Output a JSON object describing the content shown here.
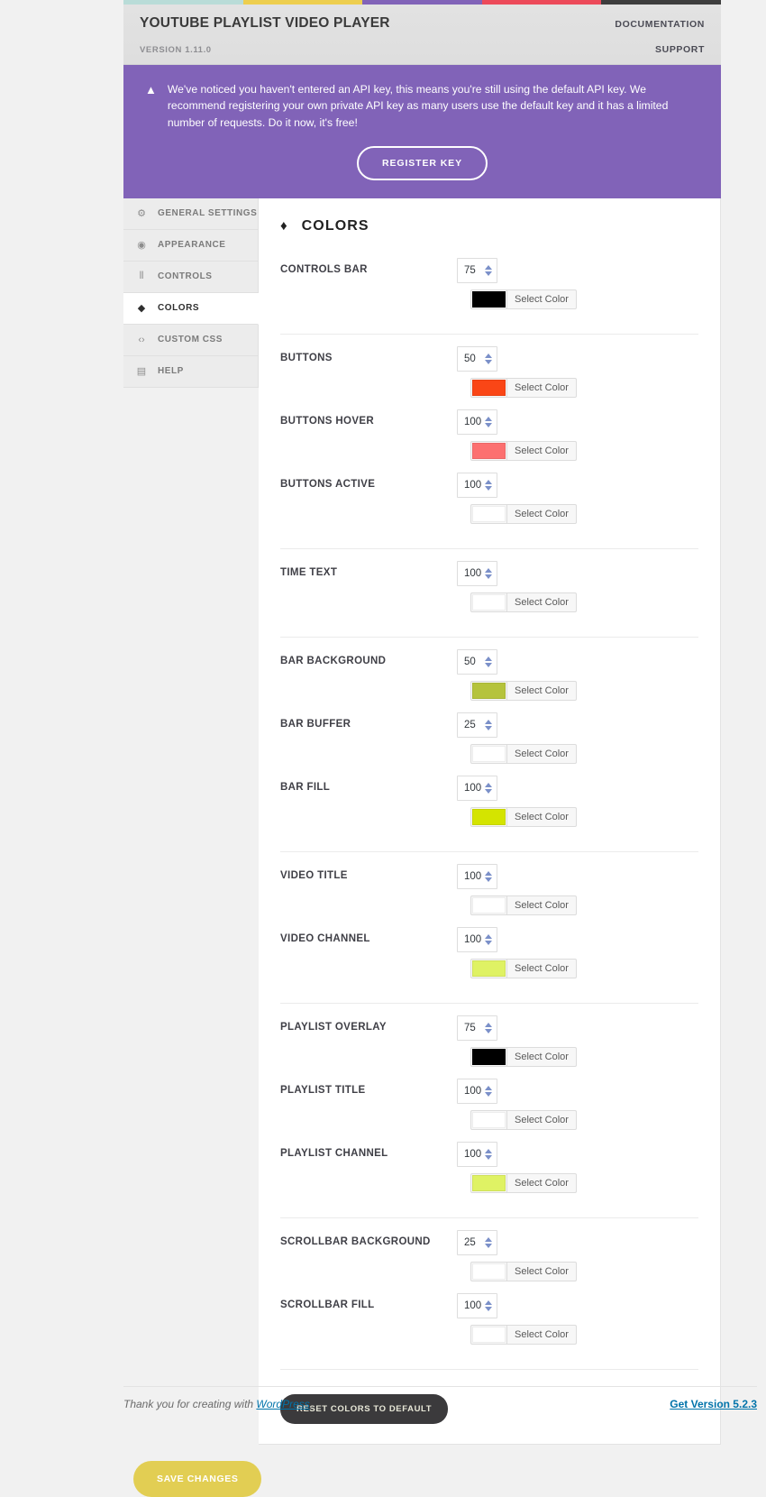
{
  "stripe_colors": [
    "#b9dcd8",
    "#edce4f",
    "#8163b8",
    "#ec4a5a",
    "#3d3d3d"
  ],
  "header": {
    "title": "YOUTUBE PLAYLIST VIDEO PLAYER",
    "version": "VERSION 1.11.0",
    "documentation": "DOCUMENTATION",
    "support": "SUPPORT"
  },
  "notice": {
    "icon": "warning-icon",
    "text": "We've noticed you haven't entered an API key, this means you're still using the default API key. We recommend registering your own private API key as many users use the default key and it has a limited number of requests. Do it now, it's free!",
    "button": "REGISTER KEY",
    "background": "#8163b8"
  },
  "sidebar": {
    "items": [
      {
        "label": "GENERAL SETTINGS",
        "icon": "gear-icon",
        "glyph": "⚙",
        "active": false
      },
      {
        "label": "APPEARANCE",
        "icon": "eye-icon",
        "glyph": "◉",
        "active": false
      },
      {
        "label": "CONTROLS",
        "icon": "sliders-icon",
        "glyph": "⦀",
        "active": false
      },
      {
        "label": "COLORS",
        "icon": "droplet-icon",
        "glyph": "◆",
        "active": true
      },
      {
        "label": "CUSTOM CSS",
        "icon": "code-icon",
        "glyph": "‹›",
        "active": false
      },
      {
        "label": "HELP",
        "icon": "book-icon",
        "glyph": "▤",
        "active": false
      }
    ]
  },
  "panel": {
    "icon": "droplet-icon",
    "title": "COLORS",
    "select_color_label": "Select Color",
    "reset_button": "RESET COLORS TO DEFAULT",
    "groups": [
      {
        "rows": [
          {
            "label": "CONTROLS BAR",
            "opacity": "75",
            "color": "#000000"
          }
        ]
      },
      {
        "rows": [
          {
            "label": "BUTTONS",
            "opacity": "50",
            "color": "#fa4616"
          },
          {
            "label": "BUTTONS HOVER",
            "opacity": "100",
            "color": "#fc7070"
          },
          {
            "label": "BUTTONS ACTIVE",
            "opacity": "100",
            "color": "#ffffff"
          }
        ]
      },
      {
        "rows": [
          {
            "label": "TIME TEXT",
            "opacity": "100",
            "color": "#ffffff"
          }
        ]
      },
      {
        "rows": [
          {
            "label": "BAR BACKGROUND",
            "opacity": "50",
            "color": "#b5c33c"
          },
          {
            "label": "BAR BUFFER",
            "opacity": "25",
            "color": "#ffffff"
          },
          {
            "label": "BAR FILL",
            "opacity": "100",
            "color": "#d4e400"
          }
        ]
      },
      {
        "rows": [
          {
            "label": "VIDEO TITLE",
            "opacity": "100",
            "color": "#ffffff"
          },
          {
            "label": "VIDEO CHANNEL",
            "opacity": "100",
            "color": "#dff264"
          }
        ]
      },
      {
        "rows": [
          {
            "label": "PLAYLIST OVERLAY",
            "opacity": "75",
            "color": "#000000"
          },
          {
            "label": "PLAYLIST TITLE",
            "opacity": "100",
            "color": "#ffffff"
          },
          {
            "label": "PLAYLIST CHANNEL",
            "opacity": "100",
            "color": "#dff264"
          }
        ]
      },
      {
        "rows": [
          {
            "label": "SCROLLBAR BACKGROUND",
            "opacity": "25",
            "color": "#ffffff"
          },
          {
            "label": "SCROLLBAR FILL",
            "opacity": "100",
            "color": "#ffffff"
          }
        ]
      }
    ]
  },
  "save": {
    "label": "SAVE CHANGES",
    "color": "#e2ce53"
  },
  "wp_footer": {
    "thanks_prefix": "Thank you for creating with ",
    "wordpress_link": "WordPress",
    "thanks_suffix": ".",
    "version_link": "Get Version 5.2.3"
  }
}
